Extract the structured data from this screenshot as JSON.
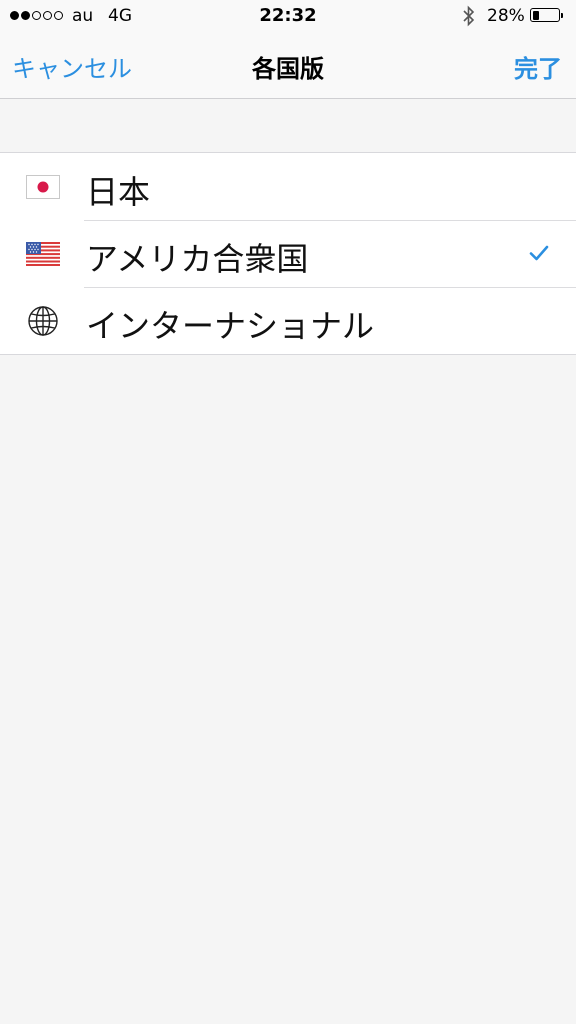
{
  "status_bar": {
    "carrier": "au",
    "network": "4G",
    "time": "22:32",
    "battery_percent": "28%",
    "battery_level": 0.28,
    "signal_bars_filled": 2,
    "signal_bars_total": 5,
    "bluetooth_icon": "bluetooth-icon"
  },
  "nav": {
    "cancel_label": "キャンセル",
    "title": "各国版",
    "done_label": "完了"
  },
  "editions": [
    {
      "label": "日本",
      "icon": "japan-flag-icon",
      "selected": false
    },
    {
      "label": "アメリカ合衆国",
      "icon": "us-flag-icon",
      "selected": true
    },
    {
      "label": "インターナショナル",
      "icon": "globe-icon",
      "selected": false
    }
  ],
  "colors": {
    "accent": "#2b8fe0",
    "background": "#f5f5f5",
    "japan_red": "#d8194a",
    "us_red": "#d93a3a",
    "us_blue": "#3b5ba8"
  }
}
